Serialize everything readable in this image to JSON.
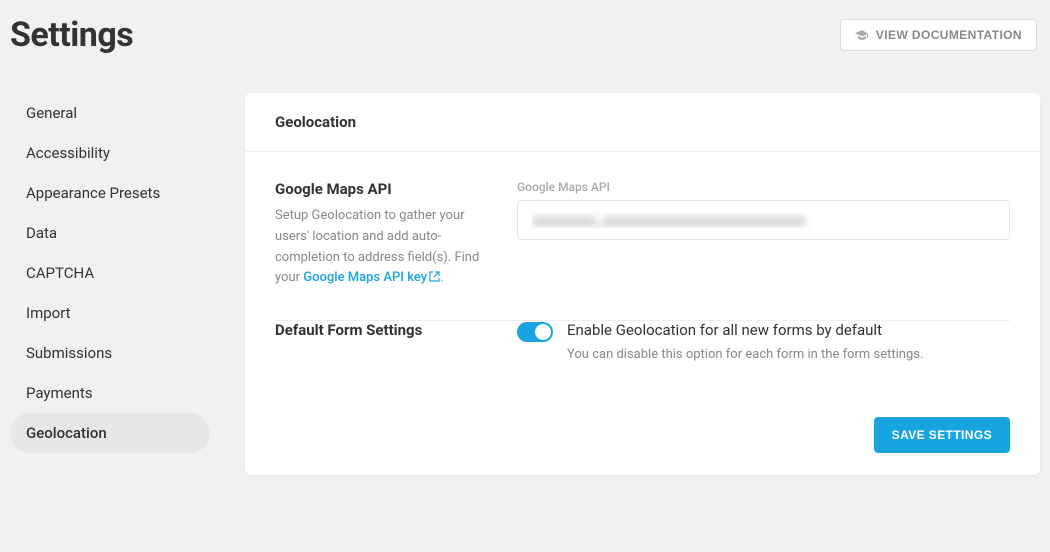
{
  "header": {
    "title": "Settings",
    "view_doc_label": "VIEW DOCUMENTATION"
  },
  "sidebar": {
    "items": [
      {
        "label": "General",
        "active": false
      },
      {
        "label": "Accessibility",
        "active": false
      },
      {
        "label": "Appearance Presets",
        "active": false
      },
      {
        "label": "Data",
        "active": false
      },
      {
        "label": "CAPTCHA",
        "active": false
      },
      {
        "label": "Import",
        "active": false
      },
      {
        "label": "Submissions",
        "active": false
      },
      {
        "label": "Payments",
        "active": false
      },
      {
        "label": "Geolocation",
        "active": true
      }
    ]
  },
  "panel": {
    "title": "Geolocation",
    "section_api": {
      "heading": "Google Maps API",
      "desc_prefix": "Setup Geolocation to gather your users' location and add auto-completion to address field(s). Find your ",
      "link_text": "Google Maps API key",
      "desc_suffix": ".",
      "field_label": "Google Maps API",
      "input_value": "xxxxxxxxx_xxxxxxxxxxxxxxxxxxxxxxxxxxxxx"
    },
    "section_default": {
      "heading": "Default Form Settings",
      "toggle_on": true,
      "toggle_label": "Enable Geolocation for all new forms by default",
      "toggle_sub": "You can disable this option for each form in the form settings."
    },
    "save_label": "SAVE SETTINGS"
  }
}
